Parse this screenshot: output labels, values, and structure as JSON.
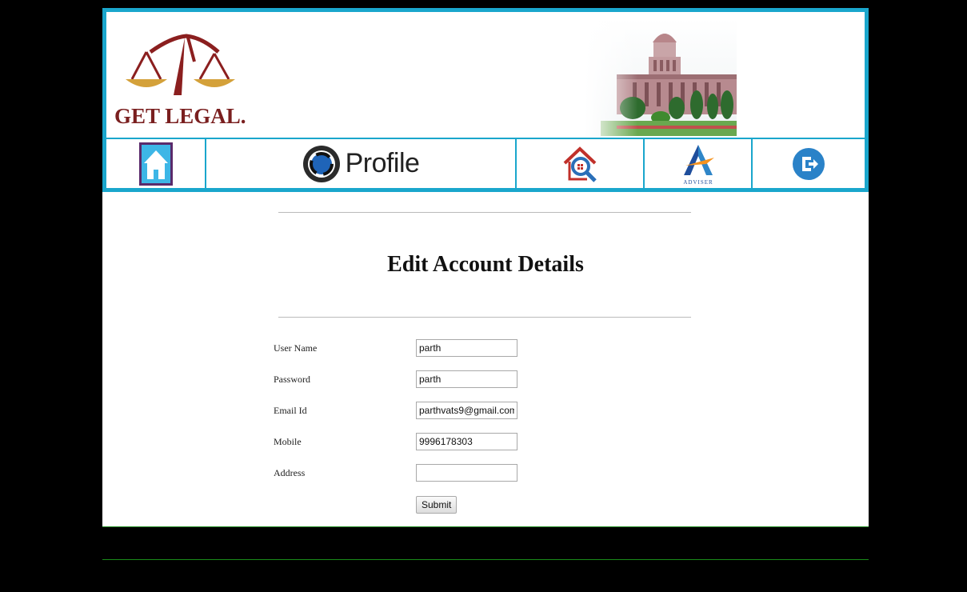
{
  "header": {
    "logo_text": "GET LEGAL.",
    "nav": [
      {
        "icon": "home-icon"
      },
      {
        "icon": "profile-icon",
        "label": "Profile"
      },
      {
        "icon": "search-house-icon"
      },
      {
        "icon": "adviser-icon",
        "label": "ADVISER"
      },
      {
        "icon": "logout-icon"
      }
    ]
  },
  "main": {
    "title": "Edit Account Details",
    "fields": [
      {
        "label": "User Name",
        "value": "parth"
      },
      {
        "label": "Password",
        "value": "parth"
      },
      {
        "label": "Email Id",
        "value": "parthvats9@gmail.com"
      },
      {
        "label": "Mobile",
        "value": "9996178303"
      },
      {
        "label": "Address",
        "value": ""
      }
    ],
    "submit_label": "Submit"
  },
  "colors": {
    "accent": "#1aa6cc",
    "logo": "#7a1f1f",
    "background": "#000000"
  }
}
